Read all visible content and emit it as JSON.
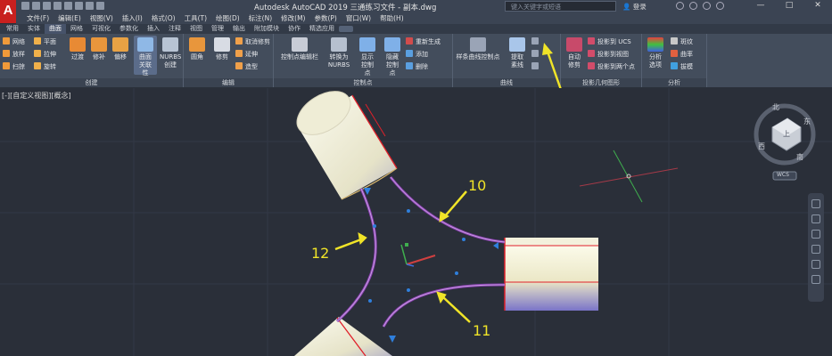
{
  "app": {
    "logo_letter": "A",
    "title": "Autodesk AutoCAD 2019    三通练习文件 - 副本.dwg",
    "search_placeholder": "键入关键字或短语",
    "login": "登录",
    "win_min": "—",
    "win_max": "□",
    "win_close": "✕"
  },
  "menu": [
    "文件(F)",
    "编辑(E)",
    "视图(V)",
    "插入(I)",
    "格式(O)",
    "工具(T)",
    "绘图(D)",
    "标注(N)",
    "修改(M)",
    "参数(P)",
    "窗口(W)",
    "帮助(H)"
  ],
  "tabs": [
    {
      "label": "常用",
      "active": false
    },
    {
      "label": "实体",
      "active": false
    },
    {
      "label": "曲面",
      "active": true
    },
    {
      "label": "网格",
      "active": false
    },
    {
      "label": "可视化",
      "active": false
    },
    {
      "label": "参数化",
      "active": false
    },
    {
      "label": "插入",
      "active": false
    },
    {
      "label": "注释",
      "active": false
    },
    {
      "label": "视图",
      "active": false
    },
    {
      "label": "管理",
      "active": false
    },
    {
      "label": "输出",
      "active": false
    },
    {
      "label": "附加模块",
      "active": false
    },
    {
      "label": "协作",
      "active": false
    },
    {
      "label": "精选应用",
      "active": false
    }
  ],
  "ribbon": {
    "create": {
      "label": "创建",
      "small": [
        "网络",
        "放样",
        "扫掠",
        "平面",
        "拉伸",
        "旋转"
      ],
      "big": [
        "过渡",
        "修补",
        "偏移",
        "曲面关联性",
        "NURBS创建"
      ]
    },
    "edit": {
      "label": "编辑",
      "big": [
        "修剪"
      ],
      "small": [
        "取消修剪",
        "延伸",
        "造型"
      ],
      "extra": "圆角"
    },
    "cv": {
      "label": "控制点",
      "big": [
        "控制点编辑栏",
        "转换为NURBS",
        "显示控制点",
        "隐藏控制点"
      ],
      "small": [
        "重新生成",
        "添加",
        "删除"
      ]
    },
    "curves": {
      "label": "曲线",
      "big": [
        "样条曲线控制点",
        "提取素线"
      ]
    },
    "project": {
      "label": "投影几何图形",
      "big": [
        "自动修剪"
      ],
      "small": [
        "投影到 UCS",
        "投影到视图",
        "投影到两个点"
      ]
    },
    "analysis": {
      "label": "分析",
      "big": [
        "分析选项"
      ],
      "small": [
        "斑纹",
        "曲率",
        "拔模"
      ]
    }
  },
  "viewport": {
    "label": "[-][自定义视图][概念]",
    "annotations": [
      "10",
      "11",
      "12"
    ],
    "viewcube": {
      "top": "北",
      "east": "东",
      "west": "西",
      "south": "南",
      "face": "上",
      "wcs": "WCS"
    }
  },
  "colors": {
    "background": "#2b3039",
    "pipe_highlight": "#8b3fb3",
    "annotation_arrow": "#f0e428",
    "selection_edge": "#e0202a",
    "grip": "#2f7fdc"
  }
}
